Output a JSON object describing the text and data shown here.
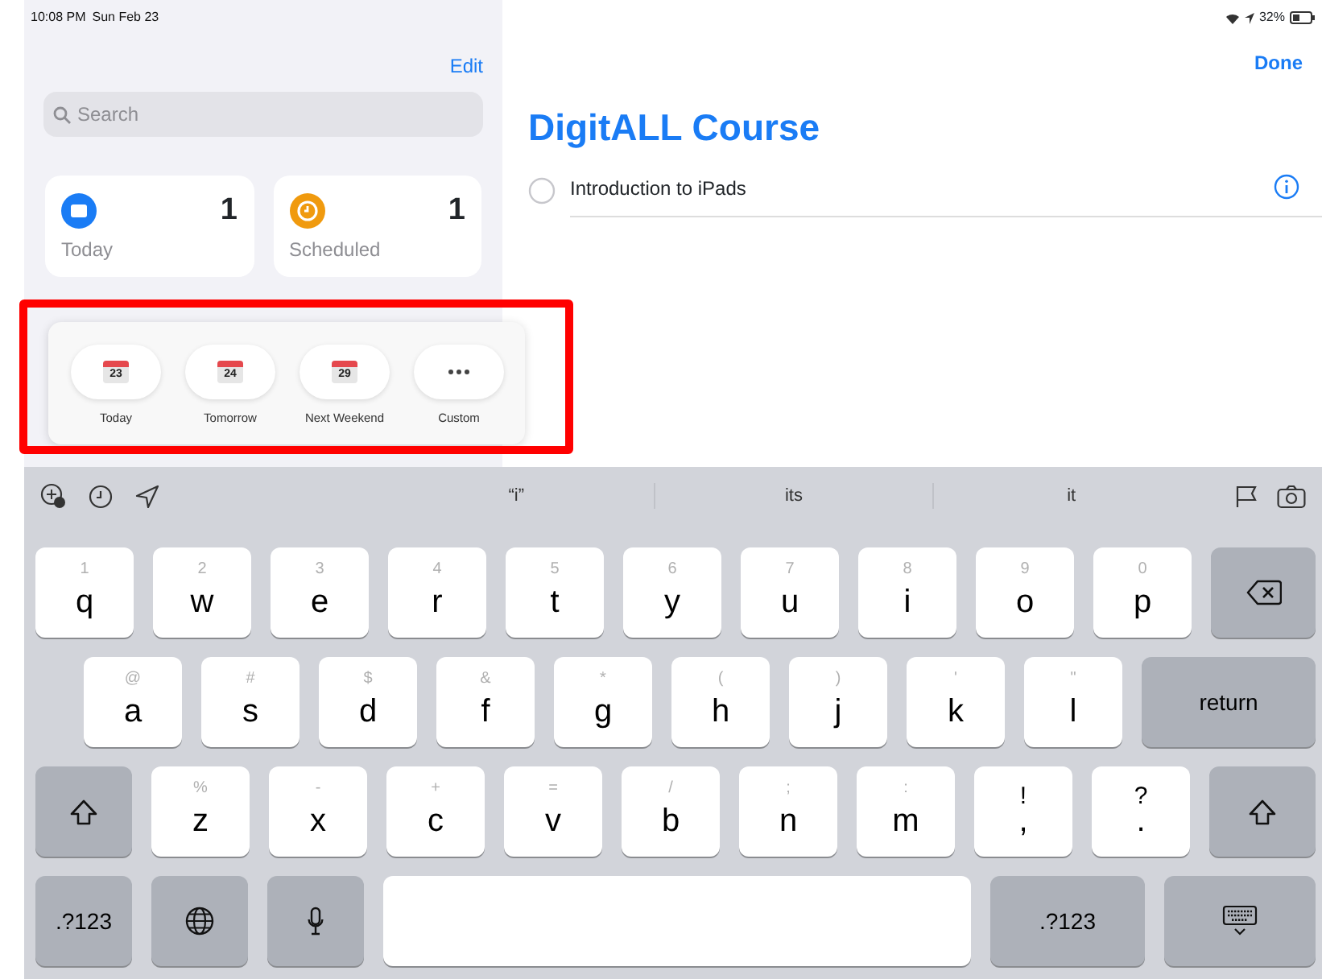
{
  "status_bar": {
    "time": "10:08 PM",
    "date": "Sun Feb 23",
    "battery": "32%"
  },
  "sidebar": {
    "edit": "Edit",
    "search": {
      "placeholder": "Search"
    },
    "smart_lists": [
      {
        "name": "Today",
        "count": "1",
        "color": "#1a7cf5"
      },
      {
        "name": "Scheduled",
        "count": "1",
        "color": "#f09a0e"
      }
    ]
  },
  "date_picker": {
    "options": [
      {
        "kind": "date",
        "day": "23",
        "label": "Today"
      },
      {
        "kind": "date",
        "day": "24",
        "label": "Tomorrow"
      },
      {
        "kind": "date",
        "day": "29",
        "label": "Next Weekend"
      },
      {
        "kind": "more",
        "label": "Custom"
      }
    ]
  },
  "detail": {
    "done": "Done",
    "title": "DigitALL Course",
    "reminders": [
      {
        "text": "Introduction to iPads",
        "completed": false
      }
    ]
  },
  "keyboard": {
    "suggestions": [
      "“i”",
      "its",
      "it"
    ],
    "rows": [
      [
        {
          "kind": "char",
          "main": "q",
          "alt": "1"
        },
        {
          "kind": "char",
          "main": "w",
          "alt": "2"
        },
        {
          "kind": "char",
          "main": "e",
          "alt": "3"
        },
        {
          "kind": "char",
          "main": "r",
          "alt": "4"
        },
        {
          "kind": "char",
          "main": "t",
          "alt": "5"
        },
        {
          "kind": "char",
          "main": "y",
          "alt": "6"
        },
        {
          "kind": "char",
          "main": "u",
          "alt": "7"
        },
        {
          "kind": "char",
          "main": "i",
          "alt": "8"
        },
        {
          "kind": "char",
          "main": "o",
          "alt": "9"
        },
        {
          "kind": "char",
          "main": "p",
          "alt": "0"
        },
        {
          "kind": "backspace"
        }
      ],
      [
        {
          "kind": "char",
          "main": "a",
          "alt": "@"
        },
        {
          "kind": "char",
          "main": "s",
          "alt": "#"
        },
        {
          "kind": "char",
          "main": "d",
          "alt": "$"
        },
        {
          "kind": "char",
          "main": "f",
          "alt": "&"
        },
        {
          "kind": "char",
          "main": "g",
          "alt": "*"
        },
        {
          "kind": "char",
          "main": "h",
          "alt": "("
        },
        {
          "kind": "char",
          "main": "j",
          "alt": ")"
        },
        {
          "kind": "char",
          "main": "k",
          "alt": "'"
        },
        {
          "kind": "char",
          "main": "l",
          "alt": "\""
        },
        {
          "kind": "return",
          "label": "return"
        }
      ],
      [
        {
          "kind": "shift"
        },
        {
          "kind": "char",
          "main": "z",
          "alt": "%"
        },
        {
          "kind": "char",
          "main": "x",
          "alt": "-"
        },
        {
          "kind": "char",
          "main": "c",
          "alt": "+"
        },
        {
          "kind": "char",
          "main": "v",
          "alt": "="
        },
        {
          "kind": "char",
          "main": "b",
          "alt": "/"
        },
        {
          "kind": "char",
          "main": "n",
          "alt": ";"
        },
        {
          "kind": "char",
          "main": "m",
          "alt": ":"
        },
        {
          "kind": "punct",
          "main": ",",
          "alt": "!"
        },
        {
          "kind": "punct",
          "main": ".",
          "alt": "?"
        },
        {
          "kind": "shift"
        }
      ],
      [
        {
          "kind": "mode",
          "label": ".?123"
        },
        {
          "kind": "globe"
        },
        {
          "kind": "mic"
        },
        {
          "kind": "space"
        },
        {
          "kind": "mode",
          "label": ".?123"
        },
        {
          "kind": "hide"
        }
      ]
    ]
  }
}
